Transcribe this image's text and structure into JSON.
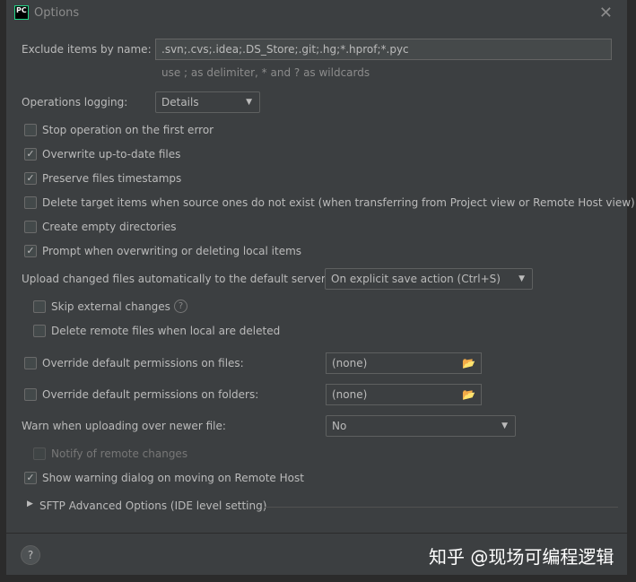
{
  "window": {
    "title": "Options",
    "logo": "PC"
  },
  "exclude": {
    "label": "Exclude items by name:",
    "value": ".svn;.cvs;.idea;.DS_Store;.git;.hg;*.hprof;*.pyc",
    "hint": "use ; as delimiter, * and ? as wildcards"
  },
  "logging": {
    "label": "Operations logging:",
    "value": "Details"
  },
  "checks": [
    {
      "label": "Stop operation on the first error",
      "checked": false
    },
    {
      "label": "Overwrite up-to-date files",
      "checked": true
    },
    {
      "label": "Preserve files timestamps",
      "checked": true
    },
    {
      "label": "Delete target items when source ones do not exist (when transferring from Project view or Remote Host view)",
      "checked": false
    },
    {
      "label": "Create empty directories",
      "checked": false
    },
    {
      "label": "Prompt when overwriting or deleting local items",
      "checked": true
    }
  ],
  "upload": {
    "label": "Upload changed files automatically to the default server",
    "value": "On explicit save action (Ctrl+S)"
  },
  "skip_external": {
    "label": "Skip external changes",
    "checked": false
  },
  "delete_remote": {
    "label": "Delete remote files when local are deleted",
    "checked": false
  },
  "perm_files": {
    "label": "Override default permissions on files:",
    "value": "(none)",
    "checked": false
  },
  "perm_folders": {
    "label": "Override default permissions on folders:",
    "value": "(none)",
    "checked": false
  },
  "warn": {
    "label": "Warn when uploading over newer file:",
    "value": "No"
  },
  "notify": {
    "label": "Notify of remote changes",
    "checked": false
  },
  "show_warning": {
    "label": "Show warning dialog on moving on Remote Host",
    "checked": true
  },
  "sftp": {
    "label": "SFTP Advanced Options (IDE level setting)"
  },
  "help": "?",
  "watermark": "知乎 @现场可编程逻辑"
}
